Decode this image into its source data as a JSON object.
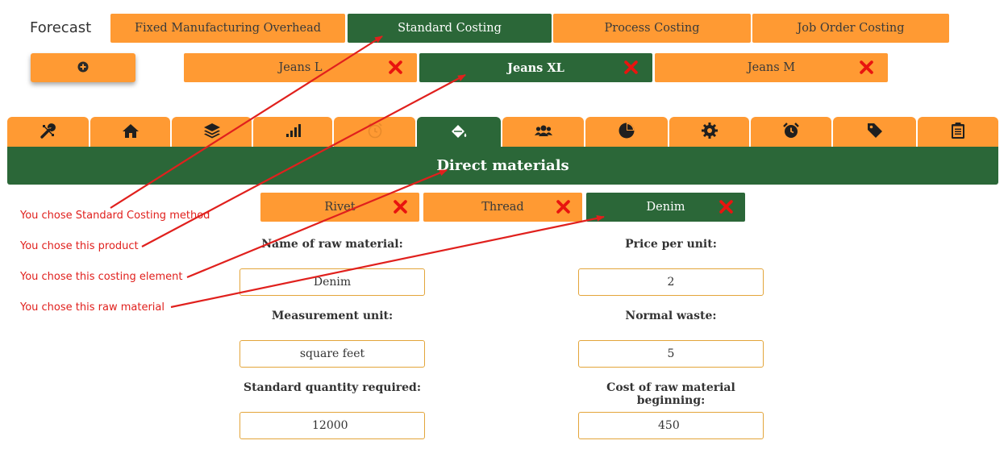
{
  "header": {
    "forecast_label": "Forecast"
  },
  "methods": [
    {
      "label": "Fixed Manufacturing Overhead",
      "active": false
    },
    {
      "label": "Standard Costing",
      "active": true
    },
    {
      "label": "Process Costing",
      "active": false
    },
    {
      "label": "Job Order Costing",
      "active": false
    }
  ],
  "add_button": {
    "icon": "plus-circle-icon"
  },
  "products": [
    {
      "label": "Jeans L",
      "active": false
    },
    {
      "label": "Jeans XL",
      "active": true
    },
    {
      "label": "Jeans M",
      "active": false
    }
  ],
  "icon_tabs": [
    {
      "icon": "tools-icon",
      "active": false
    },
    {
      "icon": "home-icon",
      "active": false
    },
    {
      "icon": "layers-icon",
      "active": false
    },
    {
      "icon": "signal-bars-icon",
      "active": false
    },
    {
      "icon": "alarm-clock-outline-icon",
      "active": false
    },
    {
      "icon": "paint-bucket-icon",
      "active": true
    },
    {
      "icon": "users-icon",
      "active": false
    },
    {
      "icon": "pie-chart-icon",
      "active": false
    },
    {
      "icon": "gear-icon",
      "active": false
    },
    {
      "icon": "alarm-clock-icon",
      "active": false
    },
    {
      "icon": "tags-icon",
      "active": false
    },
    {
      "icon": "clipboard-icon",
      "active": false
    }
  ],
  "section": {
    "title": "Direct materials"
  },
  "materials": [
    {
      "label": "Rivet",
      "active": false
    },
    {
      "label": "Thread",
      "active": false
    },
    {
      "label": "Denim",
      "active": true
    }
  ],
  "form": {
    "raw_material_name": {
      "label": "Name of raw material:",
      "value": "Denim"
    },
    "price_per_unit": {
      "label": "Price per unit:",
      "value": "2"
    },
    "measurement_unit": {
      "label": "Measurement unit:",
      "value": "square feet"
    },
    "normal_waste": {
      "label": "Normal waste:",
      "value": "5"
    },
    "standard_quantity": {
      "label": "Standard quantity required:",
      "value": "12000"
    },
    "cost_beginning": {
      "label": "Cost of raw material beginning:",
      "value": "450"
    }
  },
  "annotations": [
    "You chose Standard Costing method",
    "You chose this product",
    "You chose this costing element",
    "You chose this raw material"
  ],
  "colors": {
    "orange": "#ff9a33",
    "green": "#2b6738",
    "close_red": "#e8140f",
    "annotation_red": "#e0201d"
  }
}
